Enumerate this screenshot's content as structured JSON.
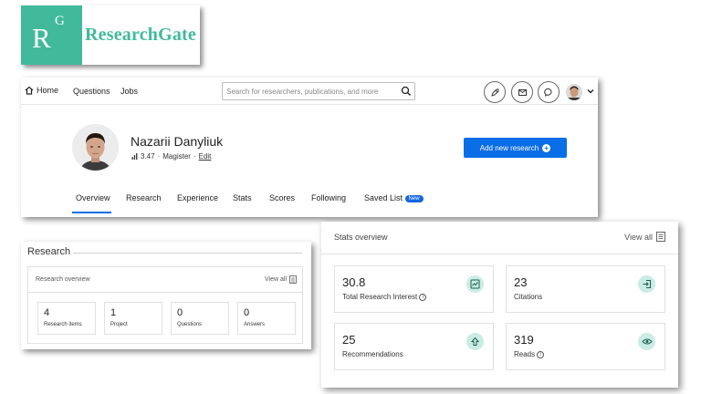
{
  "logo": {
    "mark_r": "R",
    "mark_g": "G",
    "wordmark": "ResearchGate",
    "brand_color": "#40ba9b"
  },
  "topnav": {
    "home": "Home",
    "questions": "Questions",
    "jobs": "Jobs",
    "search_placeholder": "Search for researchers, publications, and more",
    "icons": [
      "search-icon",
      "rocket-icon",
      "mail-icon",
      "chat-icon"
    ]
  },
  "profile": {
    "name": "Nazarii Danyliuk",
    "score": "3.47",
    "separator": "·",
    "degree": "Magister",
    "edit": "Edit",
    "add_button": "Add new research",
    "accent": "#0a6ee6"
  },
  "tabs": [
    {
      "label": "Overview",
      "active": true
    },
    {
      "label": "Research"
    },
    {
      "label": "Experience"
    },
    {
      "label": "Stats"
    },
    {
      "label": "Scores"
    },
    {
      "label": "Following"
    },
    {
      "label": "Saved List",
      "badge": "New"
    }
  ],
  "research": {
    "title": "Research",
    "overview_title": "Research overview",
    "view_all": "View all",
    "items": [
      {
        "value": "4",
        "label": "Research items"
      },
      {
        "value": "1",
        "label": "Project"
      },
      {
        "value": "0",
        "label": "Questions"
      },
      {
        "value": "0",
        "label": "Answers"
      }
    ]
  },
  "stats": {
    "title": "Stats overview",
    "view_all": "View all",
    "items": [
      {
        "value": "30.8",
        "label": "Total Research Interest",
        "info": true,
        "icon": "chart-icon"
      },
      {
        "value": "23",
        "label": "Citations",
        "info": false,
        "icon": "login-icon"
      },
      {
        "value": "25",
        "label": "Recommendations",
        "info": false,
        "icon": "arrow-up-icon"
      },
      {
        "value": "319",
        "label": "Reads",
        "info": true,
        "icon": "eye-icon"
      }
    ],
    "icon_bg": "#c9ece3"
  }
}
